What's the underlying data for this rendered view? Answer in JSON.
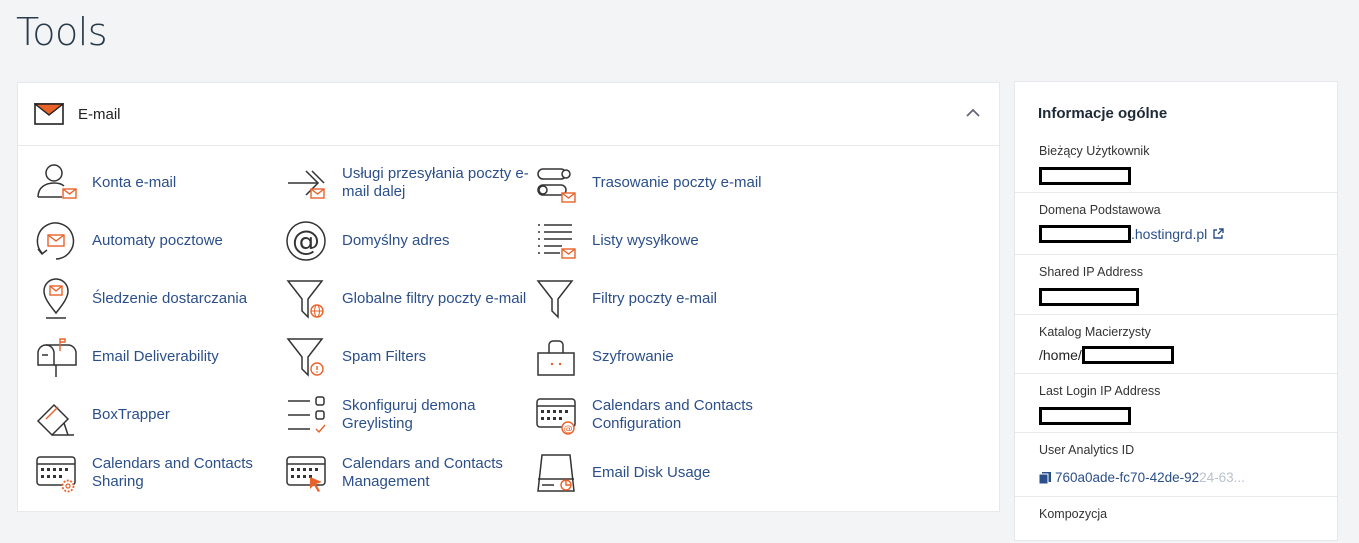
{
  "page": {
    "title": "Tools"
  },
  "email_section": {
    "title": "E-mail",
    "items": [
      {
        "label": "Konta e-mail",
        "icon": "email-accounts-icon"
      },
      {
        "label": "Usługi przesyłania poczty e-mail dalej",
        "icon": "forwarders-icon"
      },
      {
        "label": "Trasowanie poczty e-mail",
        "icon": "email-routing-icon"
      },
      {
        "label": "Automaty pocztowe",
        "icon": "autoresponders-icon"
      },
      {
        "label": "Domyślny adres",
        "icon": "default-address-icon"
      },
      {
        "label": "Listy wysyłkowe",
        "icon": "mailing-lists-icon"
      },
      {
        "label": "Śledzenie dostarczania",
        "icon": "track-delivery-icon"
      },
      {
        "label": "Globalne filtry poczty e-mail",
        "icon": "global-filters-icon"
      },
      {
        "label": "Filtry poczty e-mail",
        "icon": "email-filters-icon"
      },
      {
        "label": "Email Deliverability",
        "icon": "deliverability-icon"
      },
      {
        "label": "Spam Filters",
        "icon": "spam-filters-icon"
      },
      {
        "label": "Szyfrowanie",
        "icon": "encryption-icon"
      },
      {
        "label": "BoxTrapper",
        "icon": "boxtrapper-icon"
      },
      {
        "label": "Skonfiguruj demona Greylisting",
        "icon": "greylisting-icon"
      },
      {
        "label": "Calendars and Contacts Configuration",
        "icon": "calendar-config-icon"
      },
      {
        "label": "Calendars and Contacts Sharing",
        "icon": "calendar-sharing-icon"
      },
      {
        "label": "Calendars and Contacts Management",
        "icon": "calendar-management-icon"
      },
      {
        "label": "Email Disk Usage",
        "icon": "disk-usage-icon"
      }
    ]
  },
  "general_info": {
    "title": "Informacje ogólne",
    "current_user_label": "Bieżący Użytkownik",
    "primary_domain_label": "Domena Podstawowa",
    "primary_domain_suffix": ".hostingrd.pl",
    "shared_ip_label": "Shared IP Address",
    "home_dir_label": "Katalog Macierzysty",
    "home_dir_prefix": "/home/",
    "last_login_label": "Last Login IP Address",
    "analytics_label": "User Analytics ID",
    "analytics_id_visible": "760a0ade-fc70-42de-92",
    "analytics_id_faded": "24-63...",
    "composition_label": "Kompozycja"
  },
  "colors": {
    "accent": "#e8622a",
    "link": "#2b4f8a",
    "text": "#293a4a"
  }
}
